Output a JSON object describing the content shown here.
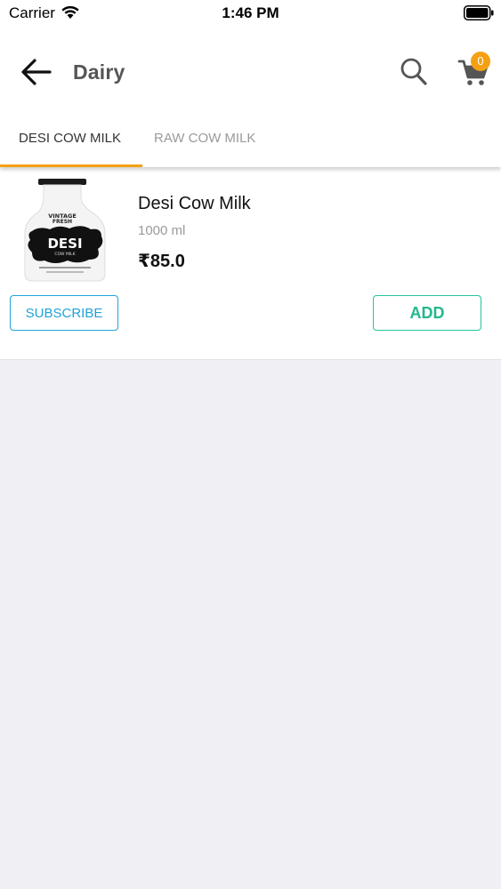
{
  "status_bar": {
    "carrier": "Carrier",
    "time": "1:46 PM",
    "icons": [
      "wifi-icon",
      "battery-icon"
    ]
  },
  "header": {
    "title": "Dairy",
    "icons": [
      "back-arrow-icon",
      "search-icon",
      "cart-icon"
    ],
    "cart_count": "0"
  },
  "tabs": [
    {
      "label": "DESI COW MILK",
      "active": true
    },
    {
      "label": "RAW COW MILK",
      "active": false
    }
  ],
  "product": {
    "name": "Desi Cow Milk",
    "quantity": "1000 ml",
    "price": "₹85.0",
    "subscribe_label": "SUBSCRIBE",
    "add_label": "ADD",
    "image_brand_line1": "VINTAGE",
    "image_brand_line2": "FRESH",
    "image_label": "DESI",
    "image_sublabel": "COW MILK"
  },
  "colors": {
    "accent_orange": "#f5a012",
    "subscribe_blue": "#1fa3d8",
    "add_green": "#21c59a",
    "background": "#f0f0f4"
  }
}
